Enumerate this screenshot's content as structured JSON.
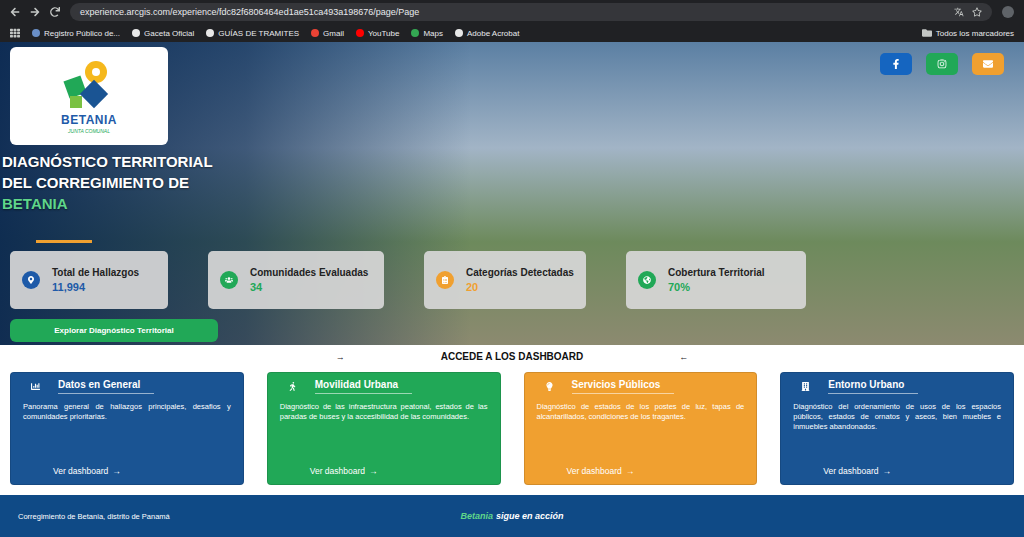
{
  "browser": {
    "url": "experience.arcgis.com/experience/fdc82f6806464ed1ae51ca493a198676/page/Page",
    "bookmarks": [
      {
        "label": "Registro Público de...",
        "color": "#6a8fc7"
      },
      {
        "label": "Gaceta Oficial",
        "color": "#e8e8e8"
      },
      {
        "label": "GUÍAS DE TRAMITES",
        "color": "#e8e8e8"
      },
      {
        "label": "Gmail",
        "color": "#ea4335"
      },
      {
        "label": "YouTube",
        "color": "#ff0000"
      },
      {
        "label": "Maps",
        "color": "#34a853"
      },
      {
        "label": "Adobe Acrobat",
        "color": "#e8e8e8"
      }
    ],
    "all_bookmarks": "Todos los marcadores"
  },
  "hero": {
    "logo": {
      "name": "BETANIA",
      "subtitle": "JUNTA COMUNAL"
    },
    "title_lines": [
      "DIAGNÓSTICO TERRITORIAL",
      "DEL CORREGIMIENTO DE"
    ],
    "title_highlight": "BETANIA",
    "social": [
      {
        "color": "#1565c0"
      },
      {
        "color": "#21a857"
      },
      {
        "color": "#f0a030"
      }
    ],
    "stats": [
      {
        "label": "Total de Hallazgos",
        "value": "11,994",
        "color": "#1e5aa8"
      },
      {
        "label": "Comunidades Evaluadas",
        "value": "34",
        "color": "#21a857"
      },
      {
        "label": "Categorías Detectadas",
        "value": "20",
        "color": "#f0a030"
      },
      {
        "label": "Cobertura Territorial",
        "value": "70%",
        "color": "#21a857"
      }
    ],
    "cta": "Explorar Diagnóstico Territorial"
  },
  "dashboards": {
    "heading": "ACCEDE A LOS DASHBOARD",
    "arrow_left": "→",
    "arrow_right": "←",
    "cards": [
      {
        "title": "Datos en General",
        "description": "Panorama general de hallazgos principales, desafios y comunidades prioritarias.",
        "link": "Ver dashboard",
        "link_arrow": "→",
        "color": "#1a5493"
      },
      {
        "title": "Movilidad Urbana",
        "description": "Diagnóstico de las infraestructura peatonal, estados de las paradas de buses y la accesibilidad de las comunidades.",
        "link": "Ver dashboard",
        "link_arrow": "→",
        "color": "#21a857"
      },
      {
        "title": "Servicios Públicos",
        "description": "Diagnóstico de estados de los postes de luz, tapas de alcantarillados, condiciones de los tragantes.",
        "link": "Ver dashboard",
        "link_arrow": "→",
        "color": "#f0a030"
      },
      {
        "title": "Entorno Urbano",
        "description": "Diagnóstico del ordenamiento de usos de los espacios públicos, estados de ornatos y aseos, bien muebles e inmuebles abandonados.",
        "link": "Ver dashboard",
        "link_arrow": "→",
        "color": "#1a5493"
      }
    ]
  },
  "footer": {
    "left": "Corregimiento de Betania, distrito de Panamá",
    "highlight": "Betania",
    "rest": "sigue en acción"
  }
}
